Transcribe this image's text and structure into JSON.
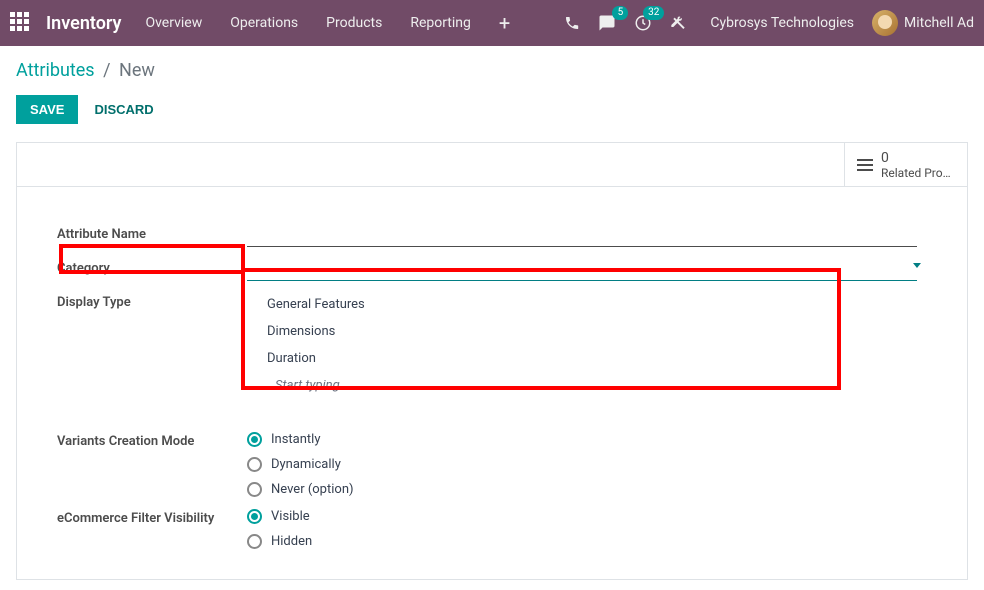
{
  "topbar": {
    "module": "Inventory",
    "nav": [
      "Overview",
      "Operations",
      "Products",
      "Reporting"
    ],
    "chat_badge": "5",
    "clock_badge": "32",
    "company": "Cybrosys Technologies",
    "user": "Mitchell Ad"
  },
  "breadcrumb": {
    "link": "Attributes",
    "current": "New"
  },
  "buttons": {
    "save": "SAVE",
    "discard": "DISCARD"
  },
  "stat": {
    "count": "0",
    "label": "Related Prod…"
  },
  "form": {
    "attribute_name_label": "Attribute Name",
    "attribute_name_value": "",
    "category_label": "Category",
    "category_value": "",
    "category_options": [
      "General Features",
      "Dimensions",
      "Duration"
    ],
    "category_start_typing": "Start typing...",
    "display_type_label": "Display Type",
    "variants_mode_label": "Variants Creation Mode",
    "variants_mode_options": [
      {
        "label": "Instantly",
        "selected": true
      },
      {
        "label": "Dynamically",
        "selected": false
      },
      {
        "label": "Never (option)",
        "selected": false
      }
    ],
    "ecommerce_label": "eCommerce Filter Visibility",
    "ecommerce_options": [
      {
        "label": "Visible",
        "selected": true
      },
      {
        "label": "Hidden",
        "selected": false
      }
    ]
  }
}
